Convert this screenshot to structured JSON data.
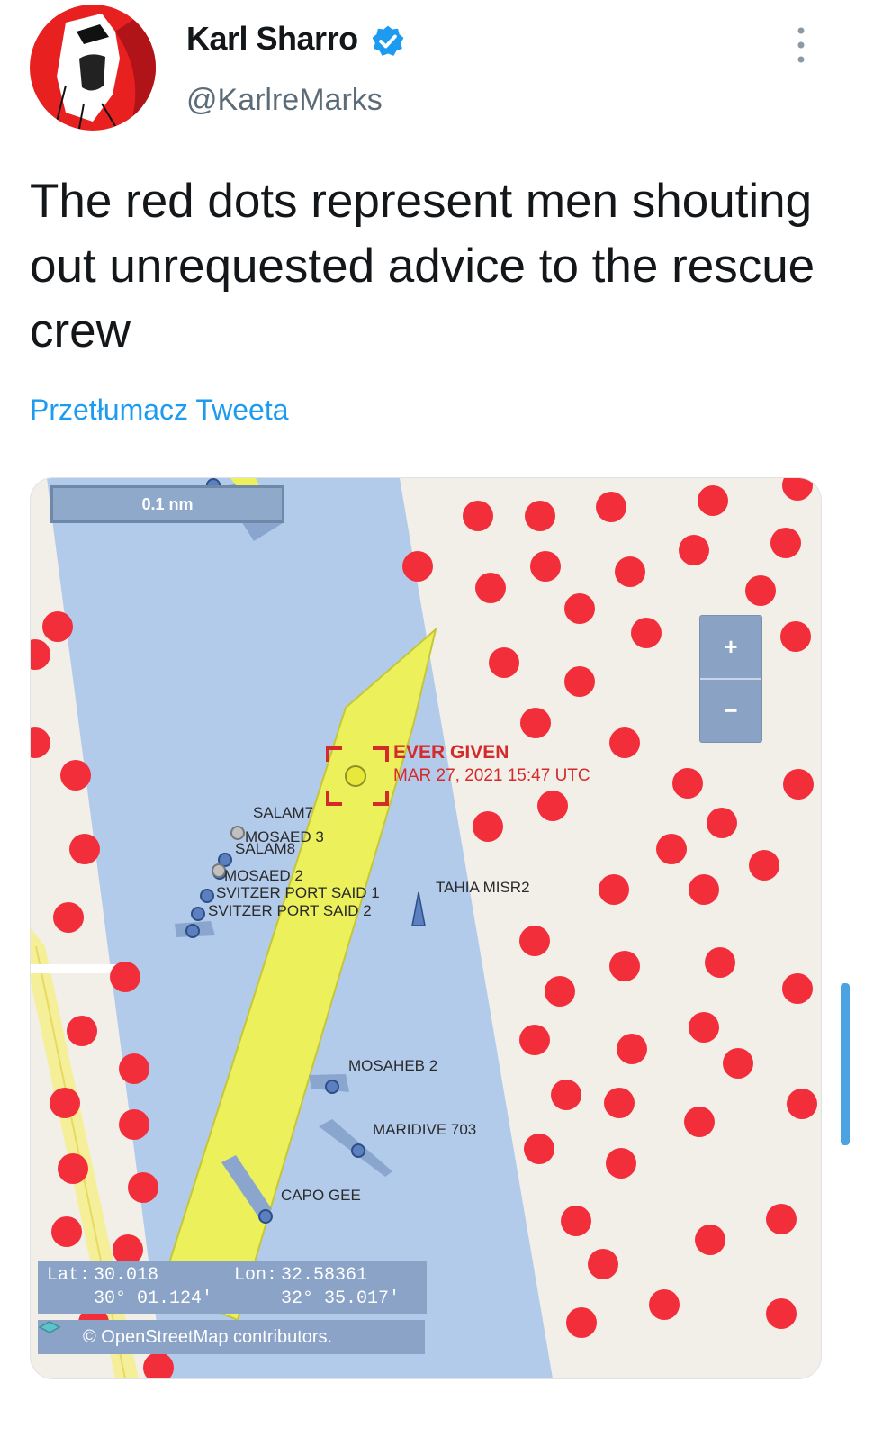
{
  "tweet": {
    "author_name": "Karl Sharro",
    "handle": "@KarlreMarks",
    "text": "The red dots represent men shouting out unrequested advice to the rescue crew",
    "translate_label": "Przetłumacz Tweeta"
  },
  "map": {
    "scale_label": "0.1 nm",
    "zoom_in": "+",
    "zoom_out": "−",
    "highlight_ship": {
      "name": "EVER GIVEN",
      "timestamp": "MAR 27, 2021 15:47 UTC"
    },
    "vessel_labels": {
      "salam7": "SALAM7",
      "mosaed3": "MOSAED 3",
      "salam8": "SALAM8",
      "mosaed2": "MOSAED 2",
      "svitzer1": "SVITZER PORT SAID 1",
      "svitzer2": "SVITZER PORT SAID 2",
      "tahia": "TAHIA MISR2",
      "mosaheb": "MOSAHEB 2",
      "maridive": "MARIDIVE 703",
      "capo": "CAPO GEE"
    },
    "coords": {
      "lat_label": "Lat:",
      "lat_value": "30.018",
      "lat_dms": "30° 01.124′",
      "lon_label": "Lon:",
      "lon_value": "32.58361",
      "lon_dms": "32° 35.017′"
    },
    "attribution": "© OpenStreetMap contributors.",
    "colors": {
      "water": "#b3cbea",
      "land": "#f2efe9",
      "red_dot": "#f22e3a",
      "ship": "#ecf05b",
      "vessel": "#7294c7"
    }
  }
}
